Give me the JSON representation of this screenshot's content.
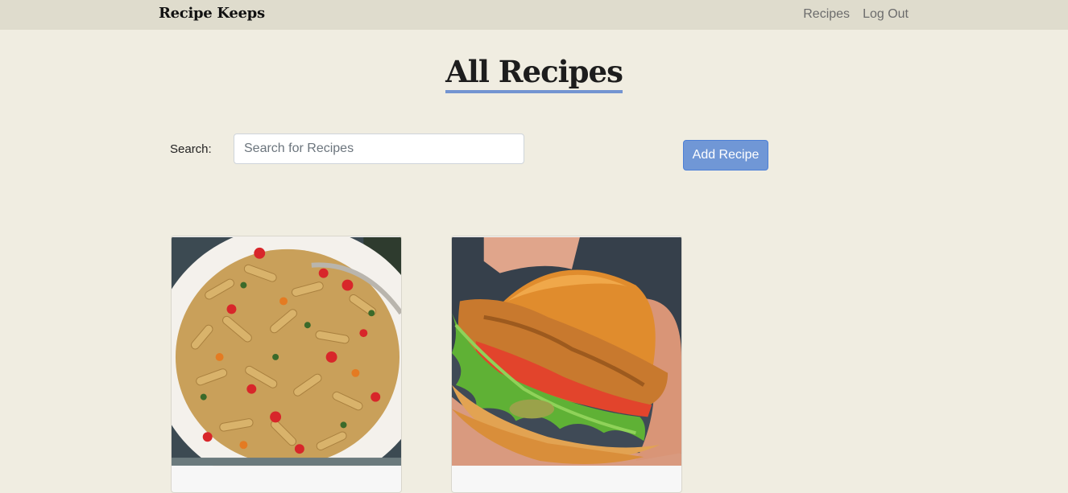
{
  "navbar": {
    "brand": "Recipe Keeps",
    "links": [
      "Recipes",
      "Log Out"
    ]
  },
  "page": {
    "title": "All Recipes"
  },
  "search": {
    "label": "Search:",
    "placeholder": "Search for Recipes",
    "value": ""
  },
  "actions": {
    "add_recipe_label": "Add Recipe"
  },
  "colors": {
    "background": "#f0ede1",
    "navbar": "#dfdccd",
    "accent": "#7097d6",
    "title_underline": "#7394d1"
  },
  "recipes": [
    {
      "image_icon": "pasta-dish-icon"
    },
    {
      "image_icon": "chicken-sandwich-icon"
    }
  ]
}
